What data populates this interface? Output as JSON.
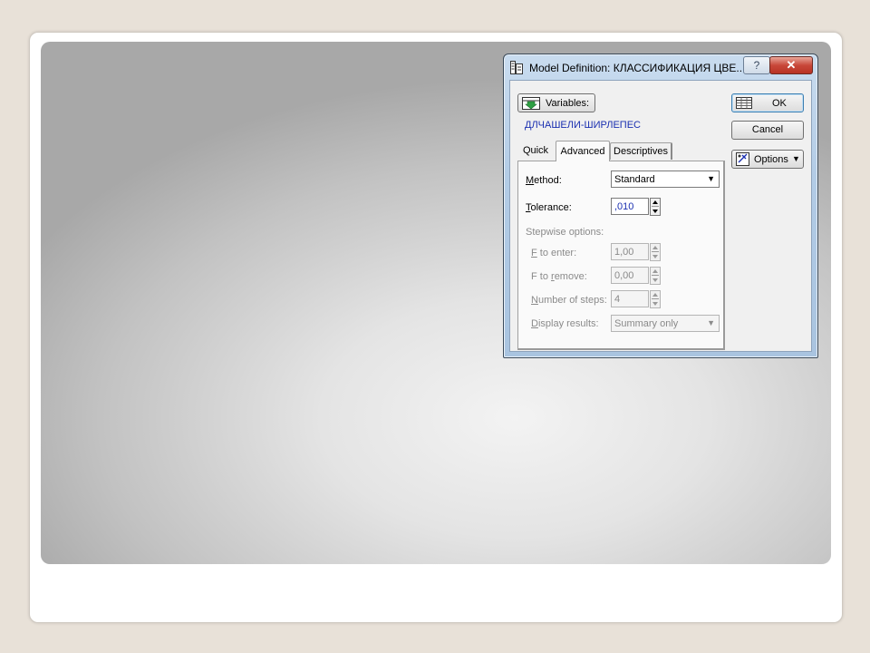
{
  "dialog": {
    "title": "Model Definition: КЛАССИФИКАЦИЯ ЦВЕ...",
    "help_label": "?",
    "close_label": "✕",
    "variables_button": "Variables:",
    "file_label": "ДЛЧАШЕЛИ-ШИРЛЕПЕС",
    "ok_label": "OK",
    "cancel_label": "Cancel",
    "options_label": "Options",
    "options_arrow": "▼",
    "tabs": [
      {
        "label": "Quick"
      },
      {
        "label": "Advanced"
      },
      {
        "label": "Descriptives"
      }
    ],
    "active_tab": "Advanced"
  },
  "advanced": {
    "method_label": "Method:",
    "method_value": "Standard",
    "tolerance_label": "Tolerance:",
    "tolerance_value": ",010",
    "stepwise_label": "Stepwise options:",
    "f_enter_label": "F to enter:",
    "f_enter_value": "1,00",
    "f_remove_label": "F to remove:",
    "f_remove_value": "0,00",
    "steps_label": "Number of steps:",
    "steps_value": "4",
    "display_label": "Display results:",
    "display_value": "Summary only",
    "dropdown_arrow": "▼"
  }
}
